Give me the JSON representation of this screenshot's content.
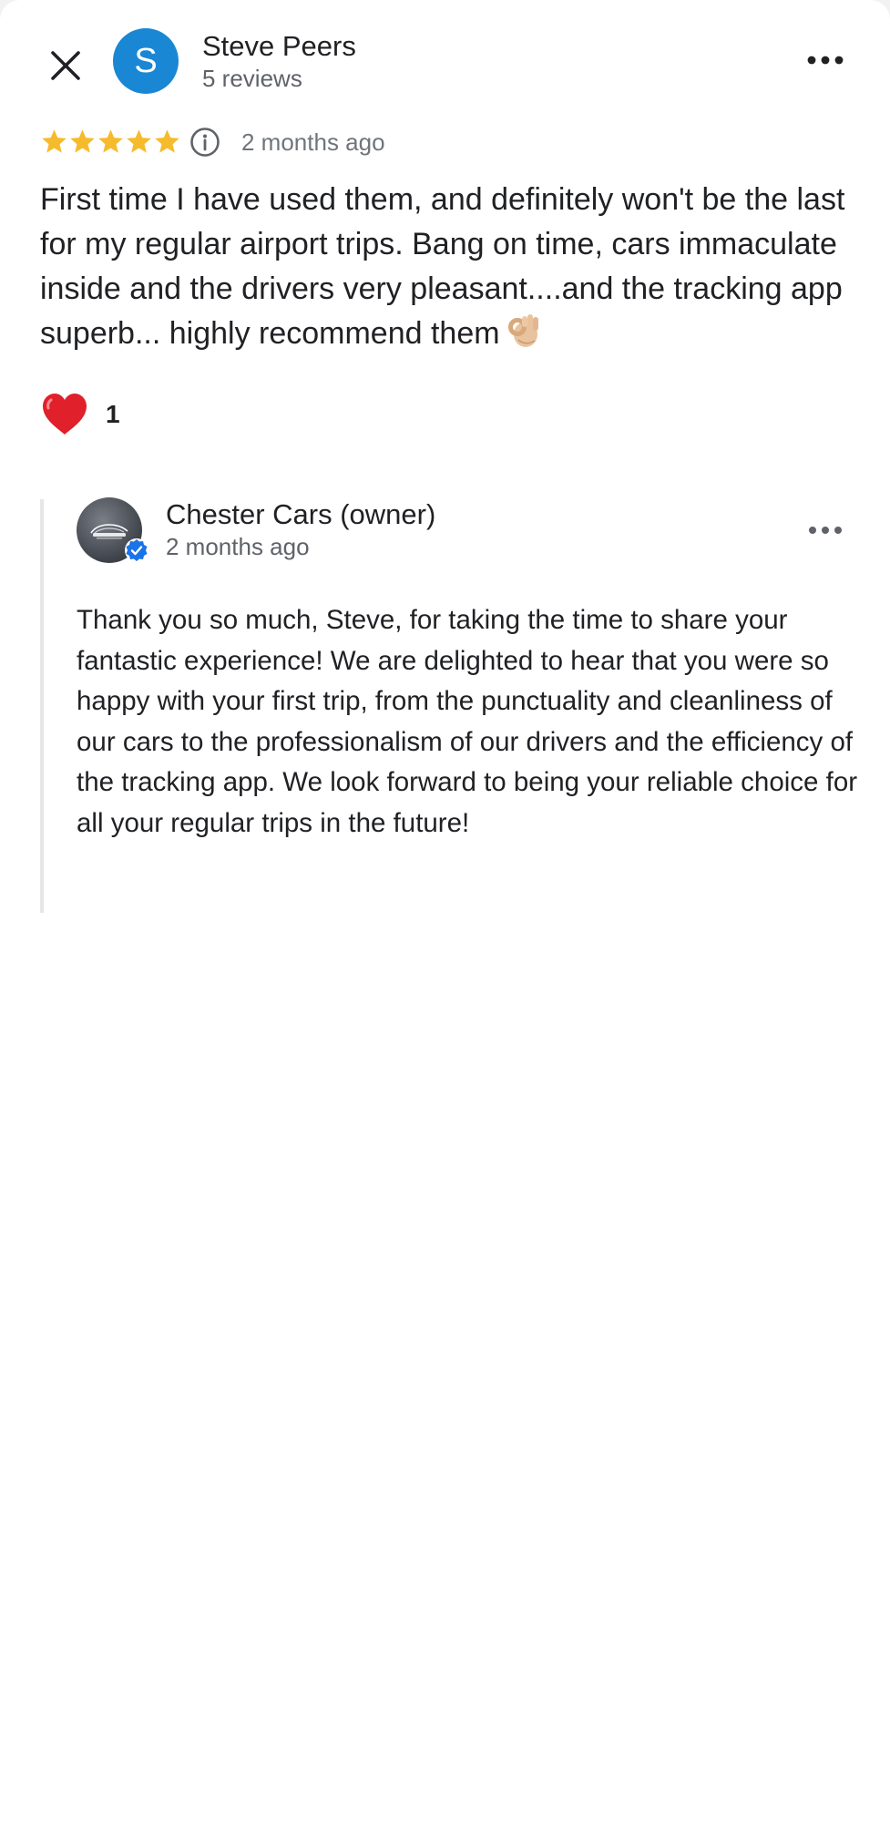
{
  "colors": {
    "avatar": "#1a87d5",
    "star": "#f6bb2c",
    "heart": "#e0202a",
    "verified": "#1a73e8"
  },
  "review": {
    "avatar_letter": "S",
    "reviewer_name": "Steve Peers",
    "reviewer_meta": "5 reviews",
    "rating": 5,
    "date": "2 months ago",
    "text": "First time I have used them, and definitely won't be the last for my regular airport trips. Bang on time, cars immaculate inside and the drivers very pleasant....and the tracking app superb... highly recommend them",
    "emoji": "ok-hand-emoji",
    "reaction_icon": "heart-icon",
    "reaction_count": "1"
  },
  "owner_reply": {
    "name": "Chester Cars (owner)",
    "date": "2 months ago",
    "text": "Thank you so much, Steve, for taking the time to share your fantastic experience! We are delighted to hear that you were so happy with your first trip, from the punctuality and cleanliness of our cars to the professionalism of our drivers and the efficiency of the tracking app. We look forward to being your reliable choice for all your regular trips in the future!"
  }
}
